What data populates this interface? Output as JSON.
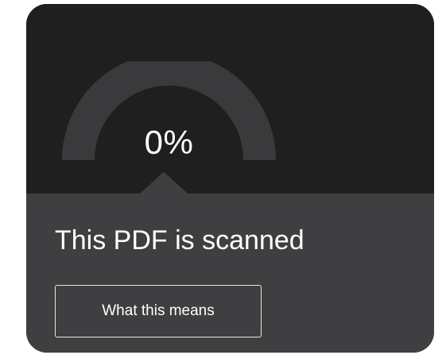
{
  "scan_card": {
    "progress_percent": 0,
    "progress_label": "0%",
    "status_text": "This PDF is scanned",
    "info_button_label": "What this means"
  },
  "colors": {
    "card_top": "#1f1f1f",
    "card_bottom": "#3f3f41",
    "gauge_track": "#3a3a3c",
    "text": "#ffffff",
    "button_border": "#e6e6e6"
  }
}
